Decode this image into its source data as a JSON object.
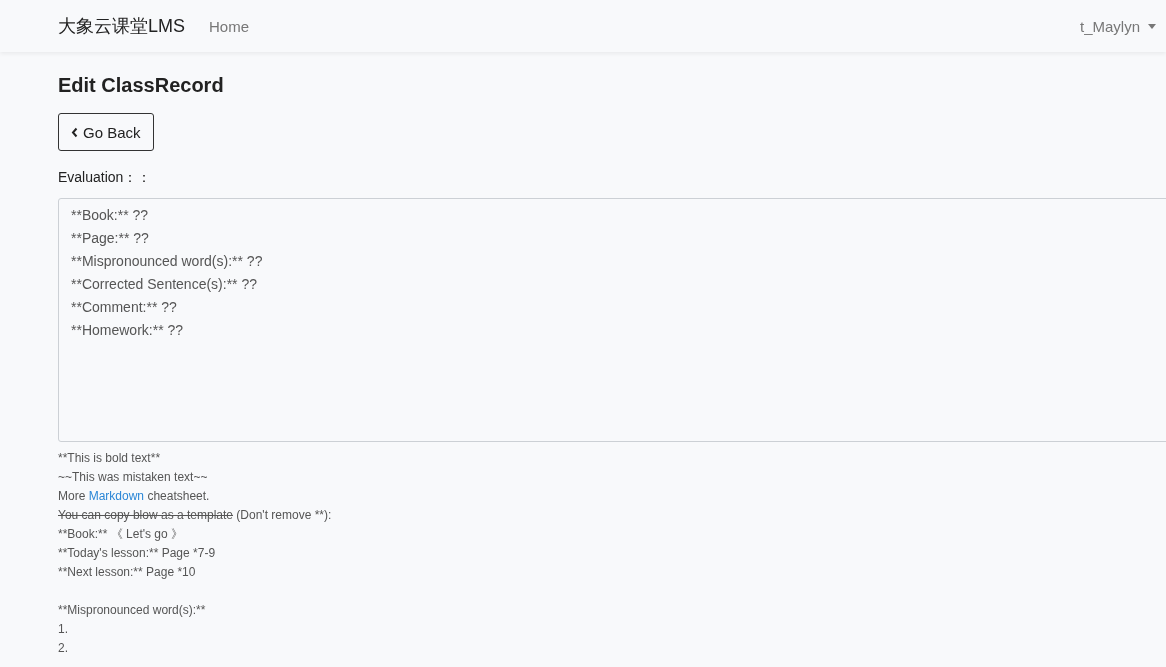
{
  "navbar": {
    "brand": "大象云课堂LMS",
    "links": [
      {
        "label": "Home"
      }
    ],
    "user": "t_Maylyn"
  },
  "page": {
    "title": "Edit ClassRecord",
    "back_button": "Go Back"
  },
  "form": {
    "label": "Evaluation：：",
    "value": "**Book:** ??\n**Page:** ??\n**Mispronounced word(s):** ??\n**Corrected Sentence(s):** ??\n**Comment:** ??\n**Homework:** ??"
  },
  "help": [
    {
      "kind": "text",
      "text": "**This is bold text**"
    },
    {
      "kind": "text",
      "text": "~~This was mistaken text~~"
    },
    {
      "kind": "link",
      "before": "More",
      "link": "Markdown",
      "after": "cheatsheet."
    },
    {
      "kind": "strike",
      "struck": "You can copy blow as a template",
      "after": "(Don't remove **):"
    },
    {
      "kind": "text",
      "text": "**Book:** 《 Let's go 》"
    },
    {
      "kind": "text",
      "text": "**Today's lesson:** Page *7-9"
    },
    {
      "kind": "text",
      "text": "**Next lesson:** Page *10"
    },
    {
      "kind": "gap"
    },
    {
      "kind": "text",
      "text": "**Mispronounced word(s):**"
    },
    {
      "kind": "text",
      "text": "1."
    },
    {
      "kind": "text",
      "text": "2."
    }
  ]
}
